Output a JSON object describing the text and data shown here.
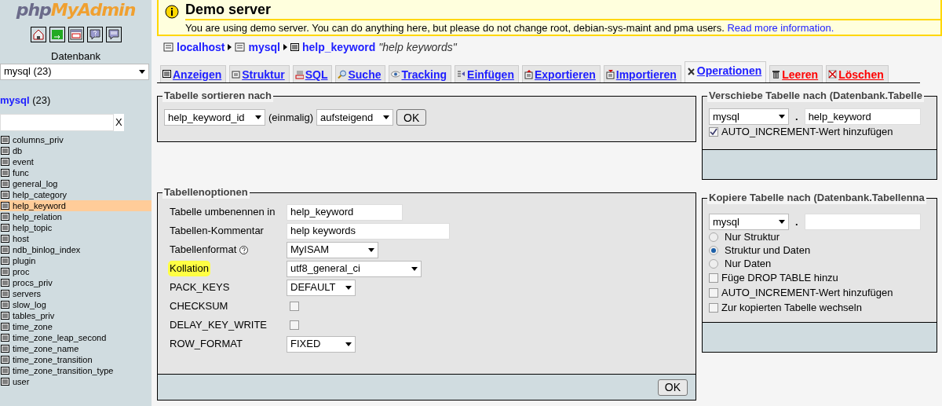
{
  "sidebar": {
    "logo": {
      "part_1": "php",
      "part_2": "MyAdmin"
    },
    "icons": [
      {
        "kind": "home"
      },
      {
        "kind": "exit"
      },
      {
        "kind": "sql"
      },
      {
        "kind": "help"
      },
      {
        "kind": "query"
      }
    ],
    "db_label": "Datenbank",
    "db_select": "mysql (23)",
    "db_link": "mysql",
    "db_count": "(23)",
    "filter_clear": "X",
    "tables": [
      {
        "name": "columns_priv",
        "selected": false
      },
      {
        "name": "db",
        "selected": false
      },
      {
        "name": "event",
        "selected": false
      },
      {
        "name": "func",
        "selected": false
      },
      {
        "name": "general_log",
        "selected": false
      },
      {
        "name": "help_category",
        "selected": false
      },
      {
        "name": "help_keyword",
        "selected": true
      },
      {
        "name": "help_relation",
        "selected": false
      },
      {
        "name": "help_topic",
        "selected": false
      },
      {
        "name": "host",
        "selected": false
      },
      {
        "name": "ndb_binlog_index",
        "selected": false
      },
      {
        "name": "plugin",
        "selected": false
      },
      {
        "name": "proc",
        "selected": false
      },
      {
        "name": "procs_priv",
        "selected": false
      },
      {
        "name": "servers",
        "selected": false
      },
      {
        "name": "slow_log",
        "selected": false
      },
      {
        "name": "tables_priv",
        "selected": false
      },
      {
        "name": "time_zone",
        "selected": false
      },
      {
        "name": "time_zone_leap_second",
        "selected": false
      },
      {
        "name": "time_zone_name",
        "selected": false
      },
      {
        "name": "time_zone_transition",
        "selected": false
      },
      {
        "name": "time_zone_transition_type",
        "selected": false
      },
      {
        "name": "user",
        "selected": false
      }
    ]
  },
  "notice": {
    "title": "Demo server",
    "text": "You are using demo server. You can do anything here, but please do not change root, debian-sys-maint and pma users.",
    "link": "Read more information."
  },
  "breadcrumb": {
    "server": "localhost",
    "database": "mysql",
    "table": "help_keyword",
    "comment": "\"help keywords\""
  },
  "tabs": [
    {
      "label": "Anzeigen",
      "kind": "normal",
      "selected": false
    },
    {
      "label": "Struktur",
      "kind": "normal",
      "selected": false
    },
    {
      "label": "SQL",
      "kind": "normal",
      "selected": false
    },
    {
      "label": "Suche",
      "kind": "normal",
      "selected": false
    },
    {
      "label": "Tracking",
      "kind": "normal",
      "selected": false
    },
    {
      "label": "Einfügen",
      "kind": "normal",
      "selected": false
    },
    {
      "label": "Exportieren",
      "kind": "normal",
      "selected": false
    },
    {
      "label": "Importieren",
      "kind": "normal",
      "selected": false
    },
    {
      "label": "Operationen",
      "kind": "normal",
      "selected": true
    },
    {
      "label": "Leeren",
      "kind": "danger",
      "selected": false
    },
    {
      "label": "Löschen",
      "kind": "danger",
      "selected": false
    }
  ],
  "sort": {
    "title": "Tabelle sortieren nach",
    "column": "help_keyword_id",
    "once": "(einmalig)",
    "order": "aufsteigend",
    "button": "OK"
  },
  "options": {
    "title": "Tabellenoptionen",
    "rows": [
      {
        "label": "Tabelle umbenennen in",
        "kind": "text",
        "value": "help_keyword",
        "highlighted": false
      },
      {
        "label": "Tabellen-Kommentar",
        "kind": "text",
        "value": "help keywords",
        "highlighted": false
      },
      {
        "label": "Tabellenformat",
        "kind": "select",
        "value": "MyISAM",
        "help": true,
        "highlighted": false
      },
      {
        "label": "Kollation",
        "kind": "select",
        "value": "utf8_general_ci",
        "highlighted": true
      },
      {
        "label": "PACK_KEYS",
        "kind": "select",
        "value": "DEFAULT",
        "highlighted": false
      },
      {
        "label": "CHECKSUM",
        "kind": "checkbox",
        "checked": false,
        "highlighted": false
      },
      {
        "label": "DELAY_KEY_WRITE",
        "kind": "checkbox",
        "checked": false,
        "highlighted": false
      },
      {
        "label": "ROW_FORMAT",
        "kind": "select",
        "value": "FIXED",
        "highlighted": false
      }
    ],
    "button": "OK"
  },
  "move": {
    "title": "Verschiebe Tabelle nach (Datenbank.Tabelle",
    "database": "mysql",
    "separator": ".",
    "table": "help_keyword",
    "checkboxes": [
      {
        "label": "AUTO_INCREMENT-Wert hinzufügen",
        "checked": true
      }
    ]
  },
  "copy": {
    "title": "Kopiere Tabelle nach (Datenbank.Tabellenna",
    "database": "mysql",
    "separator": ".",
    "radios": [
      {
        "label": "Nur Struktur",
        "selected": false
      },
      {
        "label": "Struktur und Daten",
        "selected": true
      },
      {
        "label": "Nur Daten",
        "selected": false
      }
    ],
    "checkboxes": [
      {
        "label": "Füge DROP TABLE hinzu",
        "checked": false
      },
      {
        "label": "AUTO_INCREMENT-Wert hinzufügen",
        "checked": false
      },
      {
        "label": "Zur kopierten Tabelle wechseln",
        "checked": false
      }
    ]
  }
}
